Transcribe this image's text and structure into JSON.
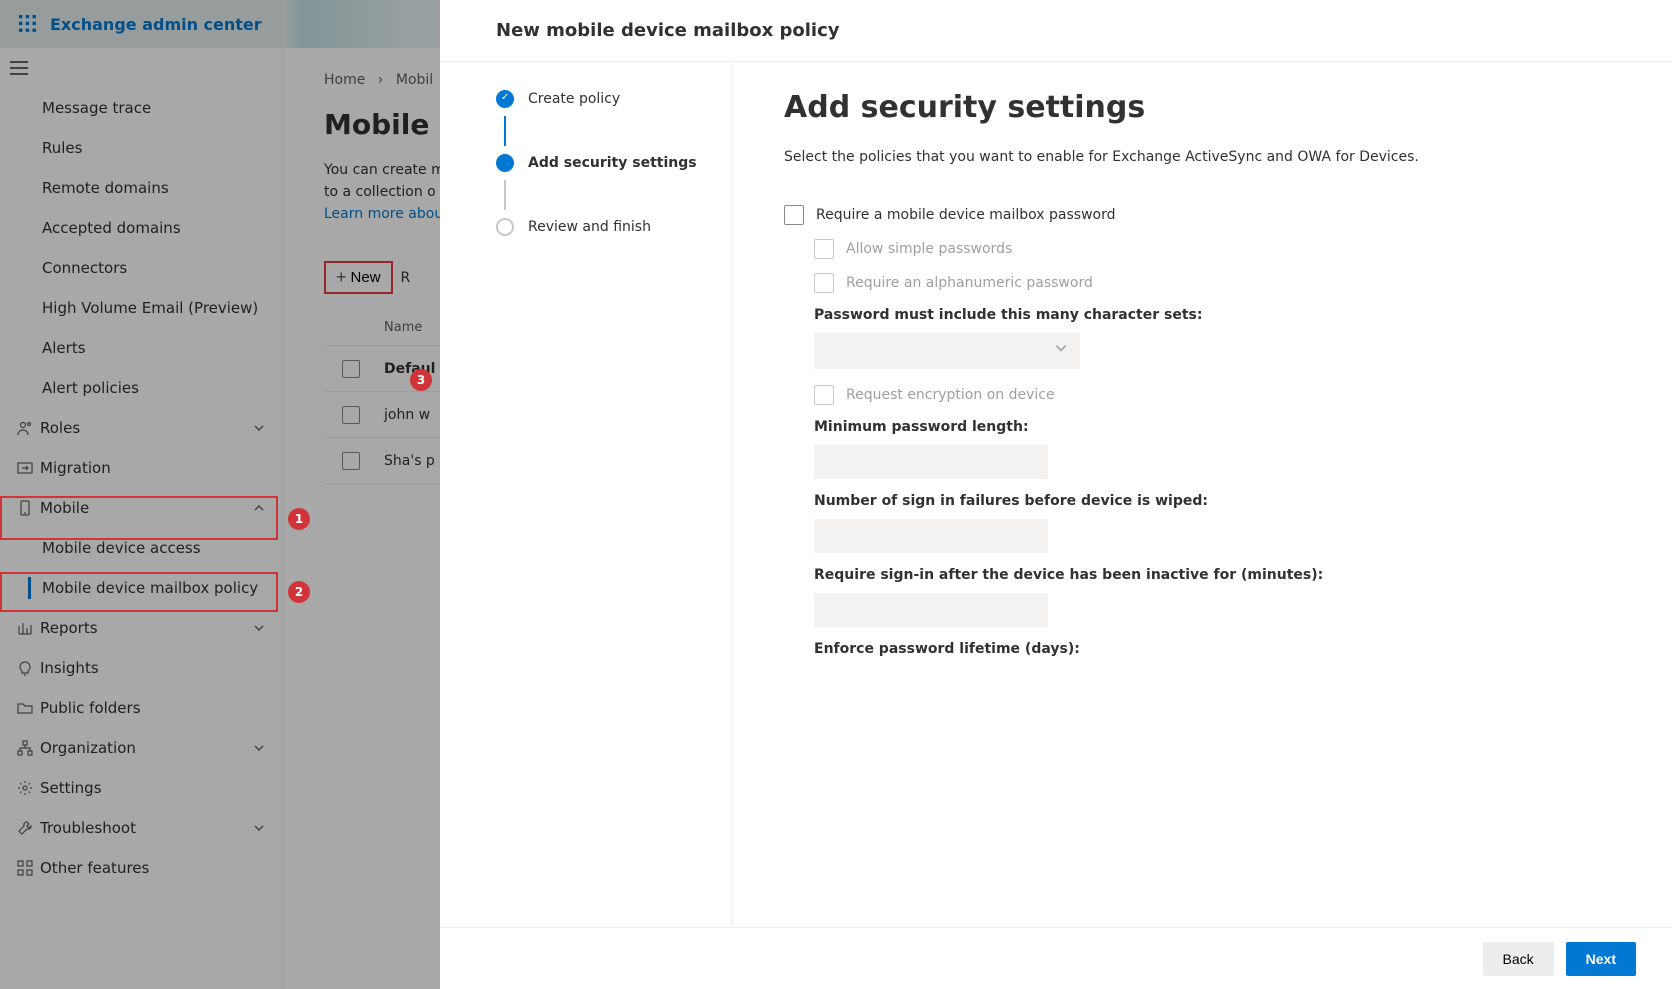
{
  "brand": "Exchange admin center",
  "sidebar": {
    "items": [
      {
        "label": "Message trace"
      },
      {
        "label": "Rules"
      },
      {
        "label": "Remote domains"
      },
      {
        "label": "Accepted domains"
      },
      {
        "label": "Connectors"
      },
      {
        "label": "High Volume Email (Preview)"
      },
      {
        "label": "Alerts"
      },
      {
        "label": "Alert policies"
      }
    ],
    "roles_label": "Roles",
    "migration_label": "Migration",
    "mobile_label": "Mobile",
    "mobile_sub": [
      {
        "label": "Mobile device access"
      },
      {
        "label": "Mobile device mailbox policy"
      }
    ],
    "reports_label": "Reports",
    "insights_label": "Insights",
    "publicfolders_label": "Public folders",
    "organization_label": "Organization",
    "settings_label": "Settings",
    "troubleshoot_label": "Troubleshoot",
    "other_label": "Other features"
  },
  "breadcrumb": {
    "home": "Home",
    "current": "Mobil"
  },
  "page": {
    "title": "Mobile ",
    "desc_line1": "You can create m",
    "desc_line2": "to a collection o",
    "learn_more": "Learn more abou"
  },
  "toolbar": {
    "new": "New",
    "refresh": "R"
  },
  "table": {
    "header": "Name",
    "rows": [
      {
        "name": "Defaul"
      },
      {
        "name": "john w"
      },
      {
        "name": "Sha's p"
      }
    ]
  },
  "callouts": {
    "1": "1",
    "2": "2",
    "3": "3"
  },
  "panel": {
    "title": "New mobile device mailbox policy",
    "steps": [
      {
        "label": "Create policy",
        "state": "done"
      },
      {
        "label": "Add security settings",
        "state": "current"
      },
      {
        "label": "Review and finish",
        "state": "pending"
      }
    ],
    "form": {
      "heading": "Add security settings",
      "lead": "Select the policies that you want to enable for Exchange ActiveSync and OWA for Devices.",
      "require_password": "Require a mobile device mailbox password",
      "allow_simple": "Allow simple passwords",
      "require_alpha": "Require an alphanumeric password",
      "char_sets_label": "Password must include this many character sets:",
      "encrypt": "Request encryption on device",
      "min_len_label": "Minimum password length:",
      "failures_label": "Number of sign in failures before device is wiped:",
      "inactive_label": "Require sign-in after the device has been inactive for (minutes):",
      "lifetime_label": "Enforce password lifetime (days):"
    },
    "footer": {
      "back": "Back",
      "next": "Next"
    }
  }
}
